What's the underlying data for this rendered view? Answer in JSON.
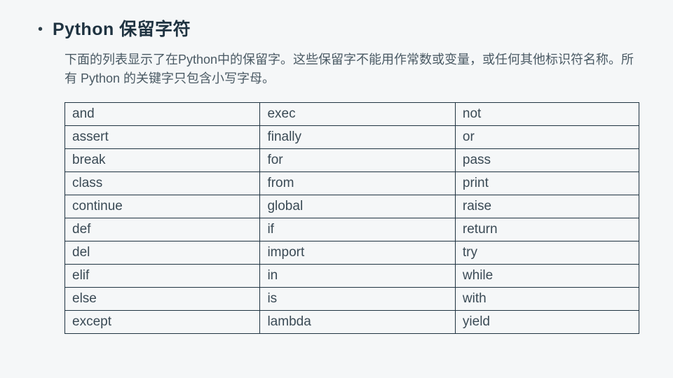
{
  "heading": "Python 保留字符",
  "description": "下面的列表显示了在Python中的保留字。这些保留字不能用作常数或变量，或任何其他标识符名称。所有 Python 的关键字只包含小写字母。",
  "table": {
    "rows": [
      {
        "c1": "and",
        "c2": "exec",
        "c3": "not"
      },
      {
        "c1": "assert",
        "c2": "finally",
        "c3": "or"
      },
      {
        "c1": "break",
        "c2": "for",
        "c3": "pass"
      },
      {
        "c1": "class",
        "c2": "from",
        "c3": "print"
      },
      {
        "c1": "continue",
        "c2": "global",
        "c3": "raise"
      },
      {
        "c1": "def",
        "c2": "if",
        "c3": "return"
      },
      {
        "c1": "del",
        "c2": "import",
        "c3": "try"
      },
      {
        "c1": "elif",
        "c2": "in",
        "c3": "while"
      },
      {
        "c1": "else",
        "c2": "is",
        "c3": "with"
      },
      {
        "c1": "except",
        "c2": "lambda",
        "c3": "yield"
      }
    ]
  }
}
